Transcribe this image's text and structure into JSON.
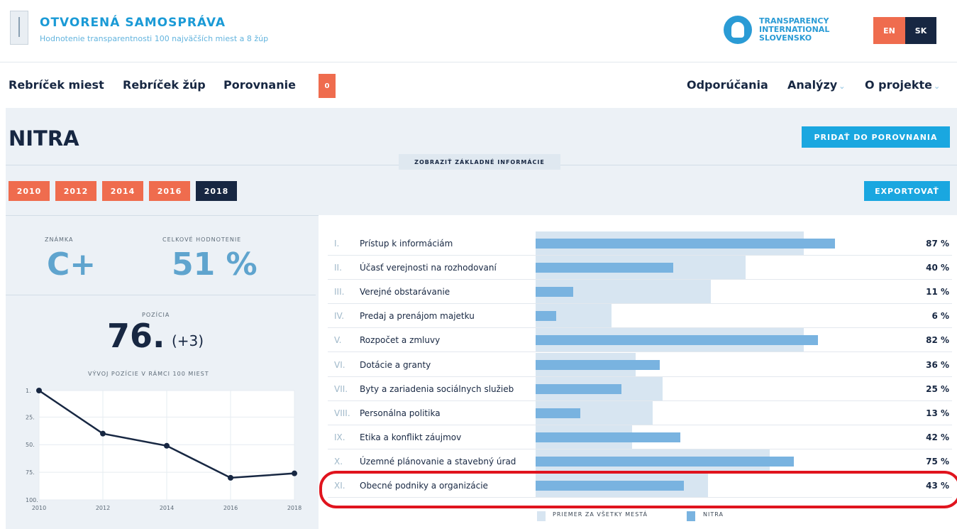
{
  "header": {
    "title": "OTVORENÁ SAMOSPRÁVA",
    "subtitle": "Hodnotenie transparentnosti 100 najväčších miest a 8 žúp",
    "partner_logo_lines": [
      "TRANSPARENCY",
      "INTERNATIONAL",
      "SLOVENSKO"
    ],
    "languages": [
      "EN",
      "SK"
    ],
    "active_language": "SK"
  },
  "nav": {
    "left": [
      "Rebríček miest",
      "Rebríček žúp",
      "Porovnanie"
    ],
    "compare_count": "0",
    "right": [
      "Odporúčania",
      "Analýzy",
      "O projekte"
    ]
  },
  "city": {
    "name": "NITRA",
    "add_compare_label": "PRIDAŤ DO POROVNANIA",
    "show_info_label": "ZOBRAZIŤ ZÁKLADNÉ INFORMÁCIE",
    "export_label": "EXPORTOVAŤ",
    "years": [
      "2010",
      "2012",
      "2014",
      "2016",
      "2018"
    ],
    "active_year": "2018"
  },
  "summary": {
    "grade_label": "ZNÁMKA",
    "grade": "C+",
    "score_label": "CELKOVÉ HODNOTENIE",
    "score": "51 %",
    "position_label": "POZÍCIA",
    "position": "76.",
    "position_change": "(+3)",
    "history_title": "VÝVOJ POZÍCIE V RÁMCI 100 MIEST"
  },
  "categories": [
    {
      "num": "I.",
      "name": "Prístup k informáciám",
      "pct": "87 %",
      "value": 87,
      "avg": 78
    },
    {
      "num": "II.",
      "name": "Účasť verejnosti na rozhodovaní",
      "pct": "40 %",
      "value": 40,
      "avg": 61
    },
    {
      "num": "III.",
      "name": "Verejné obstarávanie",
      "pct": "11 %",
      "value": 11,
      "avg": 51
    },
    {
      "num": "IV.",
      "name": "Predaj a prenájom majetku",
      "pct": "6 %",
      "value": 6,
      "avg": 22
    },
    {
      "num": "V.",
      "name": "Rozpočet a zmluvy",
      "pct": "82 %",
      "value": 82,
      "avg": 78
    },
    {
      "num": "VI.",
      "name": "Dotácie a granty",
      "pct": "36 %",
      "value": 36,
      "avg": 29
    },
    {
      "num": "VII.",
      "name": "Byty a zariadenia sociálnych služieb",
      "pct": "25 %",
      "value": 25,
      "avg": 37
    },
    {
      "num": "VIII.",
      "name": "Personálna politika",
      "pct": "13 %",
      "value": 13,
      "avg": 34
    },
    {
      "num": "IX.",
      "name": "Etika a konflikt záujmov",
      "pct": "42 %",
      "value": 42,
      "avg": 28
    },
    {
      "num": "X.",
      "name": "Územné plánovanie a stavebný úrad",
      "pct": "75 %",
      "value": 75,
      "avg": 68
    },
    {
      "num": "XI.",
      "name": "Obecné podniky a organizácie",
      "pct": "43 %",
      "value": 43,
      "avg": 50
    }
  ],
  "legend": {
    "avg_label": "PRIEMER ZA VŠETKY MESTÁ",
    "city_label": "NITRA"
  },
  "colors": {
    "accent": "#1aa7e0",
    "orange": "#ef6c4e",
    "navy": "#172742",
    "city_bar": "#79b3e0",
    "avg_bar": "#d7e5f1",
    "highlight": "#e0141e"
  },
  "chart_data": {
    "type": "line",
    "title": "VÝVOJ POZÍCIE V RÁMCI 100 MIEST",
    "x": [
      2010,
      2012,
      2014,
      2016,
      2018
    ],
    "series": [
      {
        "values": [
          1,
          40,
          51,
          80,
          76
        ]
      }
    ],
    "y_ticks": [
      "1.",
      "25.",
      "50.",
      "75.",
      "100."
    ],
    "x_ticks": [
      "2010",
      "2012",
      "2014",
      "2016",
      "2018"
    ],
    "ylim": [
      1,
      100
    ],
    "y_inverted": true,
    "grid": true
  }
}
